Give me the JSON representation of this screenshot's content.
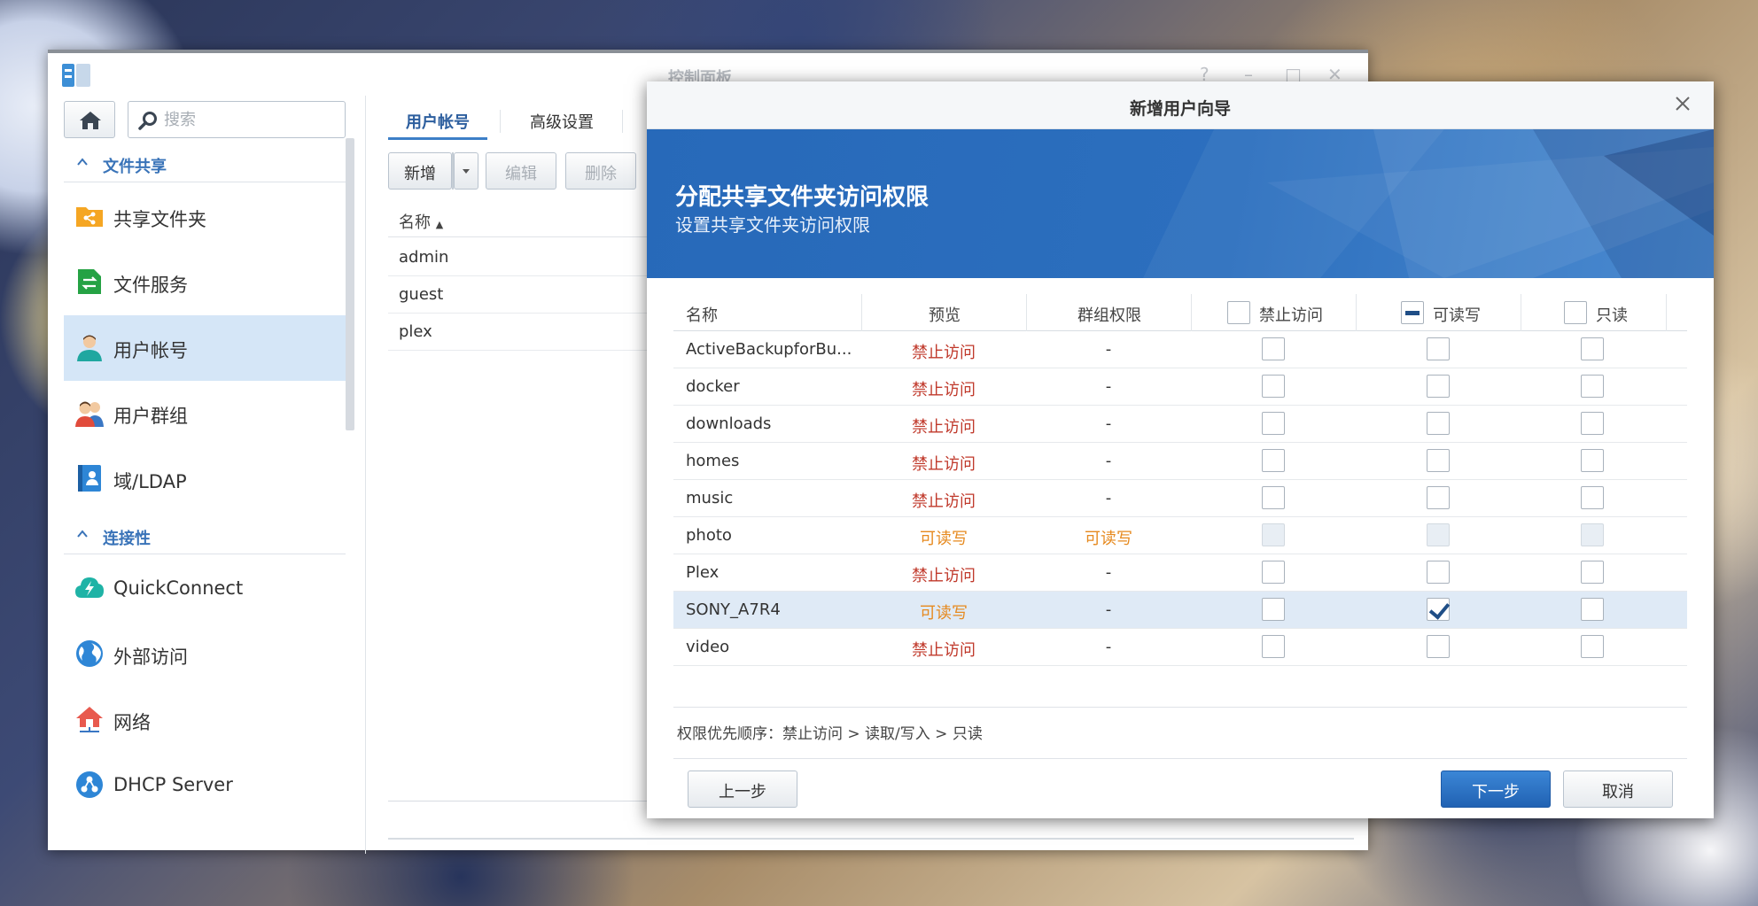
{
  "control_panel": {
    "title": "控制面板",
    "search_placeholder": "搜索",
    "sections": [
      {
        "label": "文件共享",
        "items": [
          {
            "label": "共享文件夹",
            "icon": "shared-folder-icon"
          },
          {
            "label": "文件服务",
            "icon": "file-services-icon"
          },
          {
            "label": "用户帐号",
            "icon": "user-icon",
            "active": true
          },
          {
            "label": "用户群组",
            "icon": "group-icon"
          },
          {
            "label": "域/LDAP",
            "icon": "ldap-icon"
          }
        ]
      },
      {
        "label": "连接性",
        "items": [
          {
            "label": "QuickConnect",
            "icon": "quickconnect-icon"
          },
          {
            "label": "外部访问",
            "icon": "globe-icon"
          },
          {
            "label": "网络",
            "icon": "network-house-icon"
          },
          {
            "label": "DHCP Server",
            "icon": "dhcp-icon"
          }
        ]
      }
    ],
    "tabs": [
      "用户帐号",
      "高级设置"
    ],
    "toolbar": {
      "create": "新增",
      "edit": "编辑",
      "delete": "删除"
    },
    "user_list": {
      "header": "名称",
      "rows": [
        "admin",
        "guest",
        "plex"
      ]
    }
  },
  "wizard": {
    "title": "新增用户向导",
    "heading": "分配共享文件夹访问权限",
    "subheading": "设置共享文件夹访问权限",
    "columns": {
      "name": "名称",
      "preview": "预览",
      "group_permission": "群组权限",
      "deny": "禁止访问",
      "read_write": "可读写",
      "read_only": "只读"
    },
    "rows": [
      {
        "name": "ActiveBackupforBu...",
        "preview": "禁止访问",
        "group": "-",
        "deny": false,
        "rw": false,
        "ro": false
      },
      {
        "name": "docker",
        "preview": "禁止访问",
        "group": "-",
        "deny": false,
        "rw": false,
        "ro": false
      },
      {
        "name": "downloads",
        "preview": "禁止访问",
        "group": "-",
        "deny": false,
        "rw": false,
        "ro": false
      },
      {
        "name": "homes",
        "preview": "禁止访问",
        "group": "-",
        "deny": false,
        "rw": false,
        "ro": false
      },
      {
        "name": "music",
        "preview": "禁止访问",
        "group": "-",
        "deny": false,
        "rw": false,
        "ro": false
      },
      {
        "name": "photo",
        "preview": "可读写",
        "group": "可读写",
        "disabled": true
      },
      {
        "name": "Plex",
        "preview": "禁止访问",
        "group": "-",
        "deny": false,
        "rw": false,
        "ro": false
      },
      {
        "name": "SONY_A7R4",
        "preview": "可读写",
        "group": "-",
        "deny": false,
        "rw": true,
        "ro": false,
        "selected": true
      },
      {
        "name": "video",
        "preview": "禁止访问",
        "group": "-",
        "deny": false,
        "rw": false,
        "ro": false
      }
    ],
    "priority_note": "权限优先顺序：禁止访问 > 读取/写入 > 只读",
    "buttons": {
      "back": "上一步",
      "next": "下一步",
      "cancel": "取消"
    }
  },
  "colors": {
    "accent": "#2c6fbe",
    "deny": "#c0392b",
    "read_write": "#e6891e"
  }
}
